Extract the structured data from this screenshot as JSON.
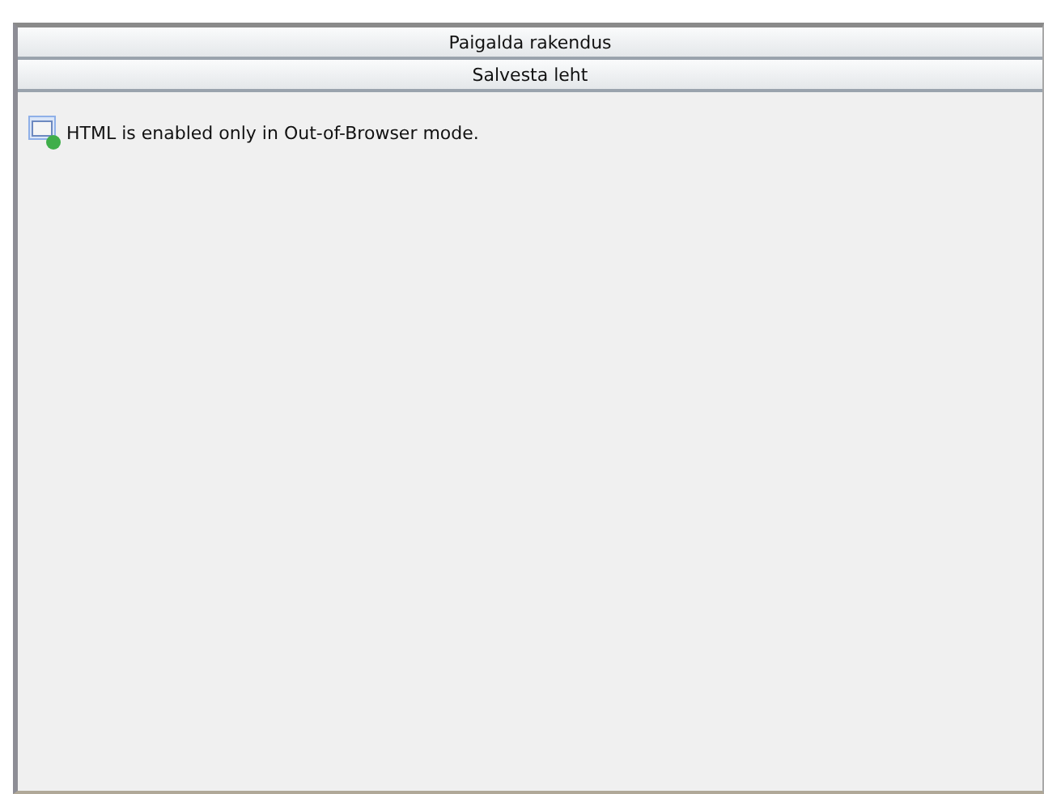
{
  "buttons": [
    "Paigalda rakendus",
    "Salvesta leht"
  ],
  "message": "HTML is enabled only in Out-of-Browser mode."
}
